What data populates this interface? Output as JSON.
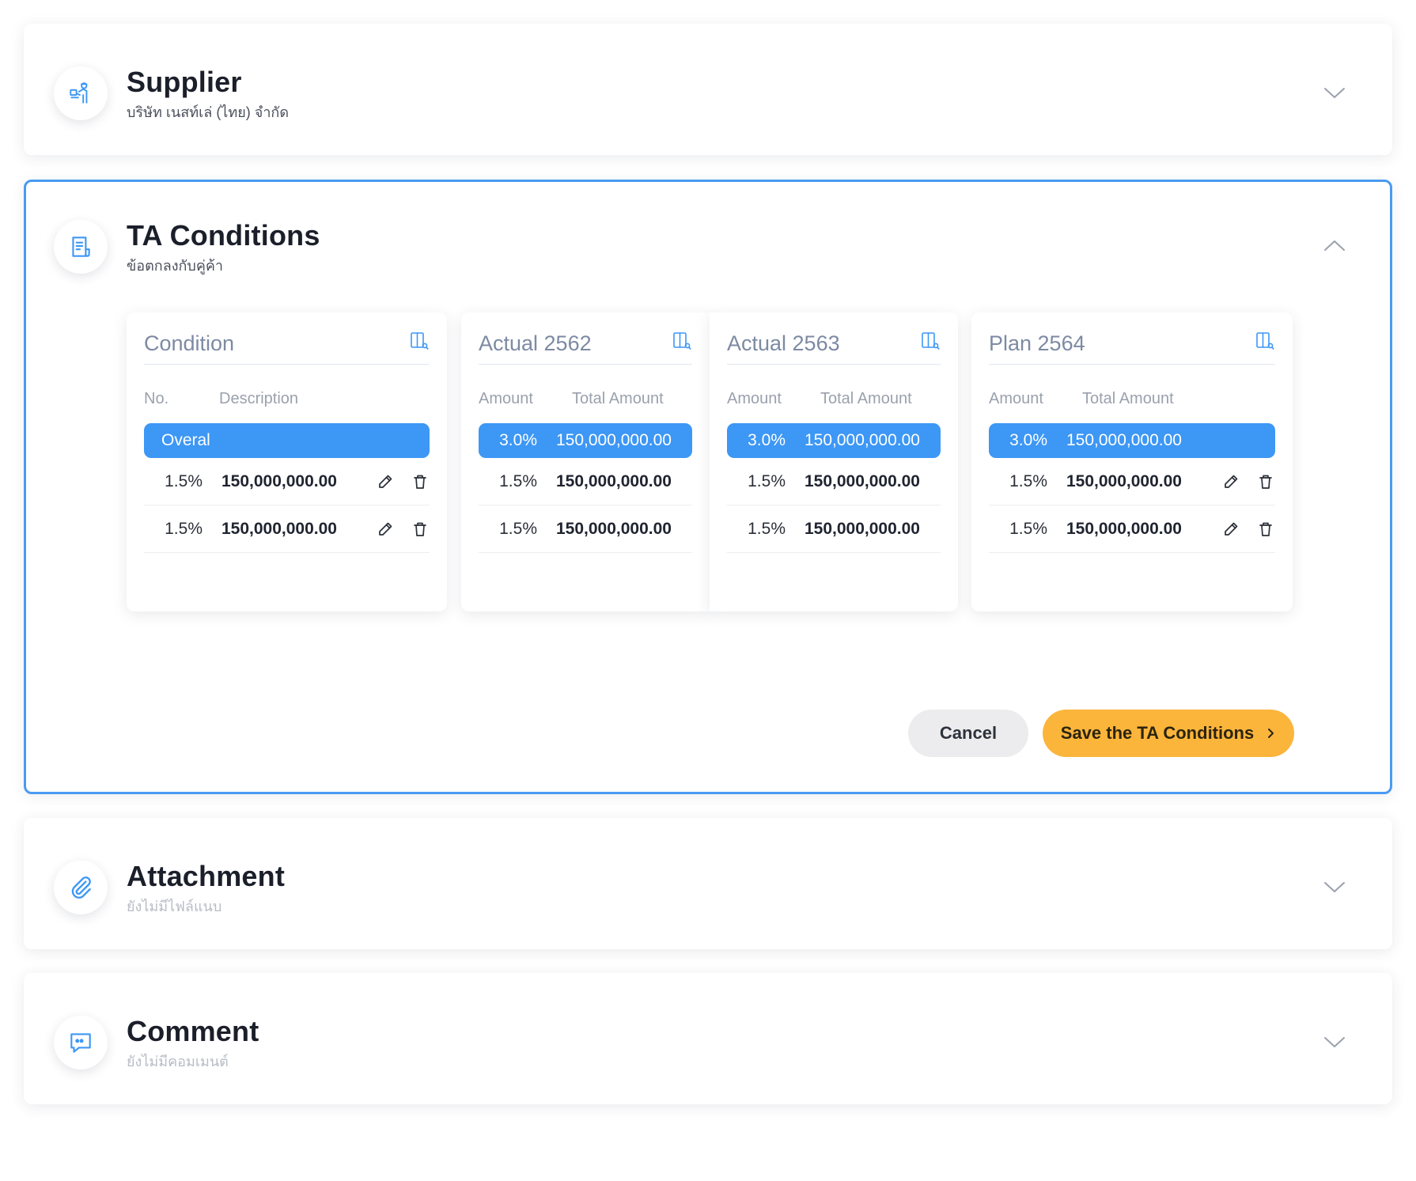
{
  "sections": {
    "supplier": {
      "title": "Supplier",
      "subtitle": "บริษัท เนสท์เล่ (ไทย) จำกัด",
      "icon": "supplier-icon"
    },
    "ta": {
      "title": "TA Conditions",
      "subtitle": "ข้อตกลงกับคู่ค้า",
      "icon": "document-icon"
    },
    "attachment": {
      "title": "Attachment",
      "subtitle": "ยังไม่มีไฟล์แนบ",
      "icon": "paperclip-icon"
    },
    "comment": {
      "title": "Comment",
      "subtitle": "ยังไม่มีคอมเมนต์",
      "icon": "chat-icon"
    }
  },
  "columns": {
    "condition": {
      "title": "Condition",
      "head_no": "No.",
      "head_desc": "Description",
      "highlight": "Overal",
      "rows": [
        {
          "pct": "1.5%",
          "amt": "150,000,000.00"
        },
        {
          "pct": "1.5%",
          "amt": "150,000,000.00"
        }
      ]
    },
    "actual2562": {
      "title": "Actual 2562",
      "head_amount": "Amount",
      "head_total": "Total Amount",
      "highlight": {
        "pct": "3.0%",
        "amt": "150,000,000.00"
      },
      "rows": [
        {
          "pct": "1.5%",
          "amt": "150,000,000.00"
        },
        {
          "pct": "1.5%",
          "amt": "150,000,000.00"
        }
      ]
    },
    "actual2563": {
      "title": "Actual 2563",
      "head_amount": "Amount",
      "head_total": "Total Amount",
      "highlight": {
        "pct": "3.0%",
        "amt": "150,000,000.00"
      },
      "rows": [
        {
          "pct": "1.5%",
          "amt": "150,000,000.00"
        },
        {
          "pct": "1.5%",
          "amt": "150,000,000.00"
        }
      ]
    },
    "plan2564": {
      "title": "Plan 2564",
      "head_amount": "Amount",
      "head_total": "Total Amount",
      "highlight": {
        "pct": "3.0%",
        "amt": "150,000,000.00"
      },
      "rows": [
        {
          "pct": "1.5%",
          "amt": "150,000,000.00"
        },
        {
          "pct": "1.5%",
          "amt": "150,000,000.00"
        }
      ]
    }
  },
  "buttons": {
    "cancel": "Cancel",
    "save": "Save the TA Conditions"
  },
  "colors": {
    "accent": "#3d97f5",
    "save": "#fcb53b",
    "cancel_bg": "#ececef",
    "ta_border": "#4a9af2"
  }
}
